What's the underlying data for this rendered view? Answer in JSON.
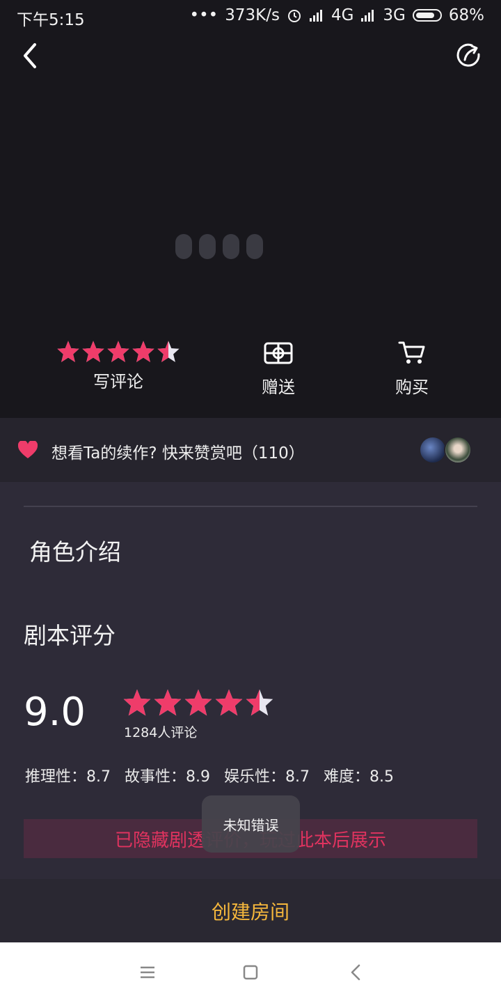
{
  "status_bar": {
    "time": "下午5:15",
    "dots": "•••",
    "speed": "373K/s",
    "network1": "4G",
    "network2": "3G",
    "battery": "68%"
  },
  "actions": {
    "rate_label": "写评论",
    "rating_stars": 4.5,
    "gift_label": "赠送",
    "buy_label": "购买"
  },
  "donate": {
    "text": "想看Ta的续作? 快来赞赏吧（110）"
  },
  "sections": {
    "role_title": "角色介绍",
    "score_title": "剧本评分"
  },
  "score": {
    "value": "9.0",
    "stars": 4.5,
    "review_count": "1284人评论",
    "sub": [
      {
        "label": "推理性：8.7"
      },
      {
        "label": "故事性：8.9"
      },
      {
        "label": "娱乐性：8.7"
      },
      {
        "label": "难度：8.5"
      }
    ]
  },
  "hidden_notice": "已隐藏剧透评价，玩过此本后展示",
  "toast": "未知错误",
  "create_button": "创建房间",
  "colors": {
    "accent_pink": "#ef3c6a",
    "create_orange": "#f5b73c",
    "hidden_text": "#e0335f"
  }
}
